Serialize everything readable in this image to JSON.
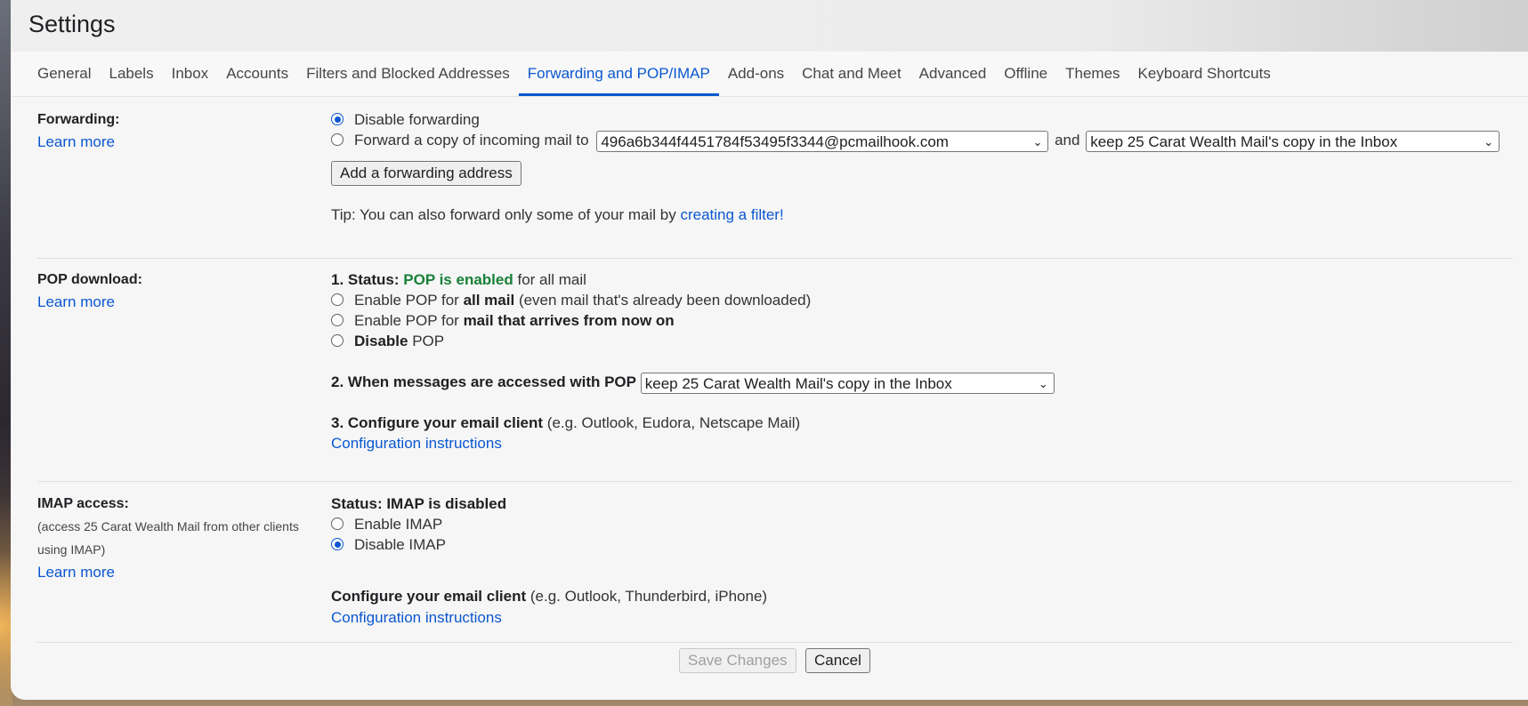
{
  "page_title": "Settings",
  "tabs": [
    {
      "label": "General"
    },
    {
      "label": "Labels"
    },
    {
      "label": "Inbox"
    },
    {
      "label": "Accounts"
    },
    {
      "label": "Filters and Blocked Addresses"
    },
    {
      "label": "Forwarding and POP/IMAP",
      "active": true
    },
    {
      "label": "Add-ons"
    },
    {
      "label": "Chat and Meet"
    },
    {
      "label": "Advanced"
    },
    {
      "label": "Offline"
    },
    {
      "label": "Themes"
    },
    {
      "label": "Keyboard Shortcuts"
    }
  ],
  "forwarding": {
    "label": "Forwarding:",
    "learn_more": "Learn more",
    "disable_label": "Disable forwarding",
    "forward_label": "Forward a copy of incoming mail to",
    "forward_address": "496a6b344f4451784f53495f3344@pcmailhook.com",
    "and_text": "and",
    "copy_action": "keep 25 Carat Wealth Mail's copy in the Inbox",
    "add_address_button": "Add a forwarding address",
    "tip_text": "Tip: You can also forward only some of your mail by",
    "tip_link": "creating a filter!"
  },
  "pop": {
    "label": "POP download:",
    "learn_more": "Learn more",
    "status_prefix": "1. Status:",
    "status_value": "POP is enabled",
    "status_suffix": "for all mail",
    "opt1_prefix": "Enable POP for",
    "opt1_bold": "all mail",
    "opt1_suffix": "(even mail that's already been downloaded)",
    "opt2_prefix": "Enable POP for",
    "opt2_bold": "mail that arrives from now on",
    "opt3_bold": "Disable",
    "opt3_suffix": "POP",
    "accessed_label": "2. When messages are accessed with POP",
    "accessed_value": "keep 25 Carat Wealth Mail's copy in the Inbox",
    "configure_bold": "3. Configure your email client",
    "configure_suffix": "(e.g. Outlook, Eudora, Netscape Mail)",
    "config_link": "Configuration instructions"
  },
  "imap": {
    "label": "IMAP access:",
    "sub_line1": "(access 25 Carat Wealth Mail from other clients",
    "sub_line2": "using IMAP)",
    "learn_more": "Learn more",
    "status": "Status: IMAP is disabled",
    "enable_label": "Enable IMAP",
    "disable_label": "Disable IMAP",
    "configure_bold": "Configure your email client",
    "configure_suffix": "(e.g. Outlook, Thunderbird, iPhone)",
    "config_link": "Configuration instructions"
  },
  "footer": {
    "save_label": "Save Changes",
    "cancel_label": "Cancel"
  }
}
